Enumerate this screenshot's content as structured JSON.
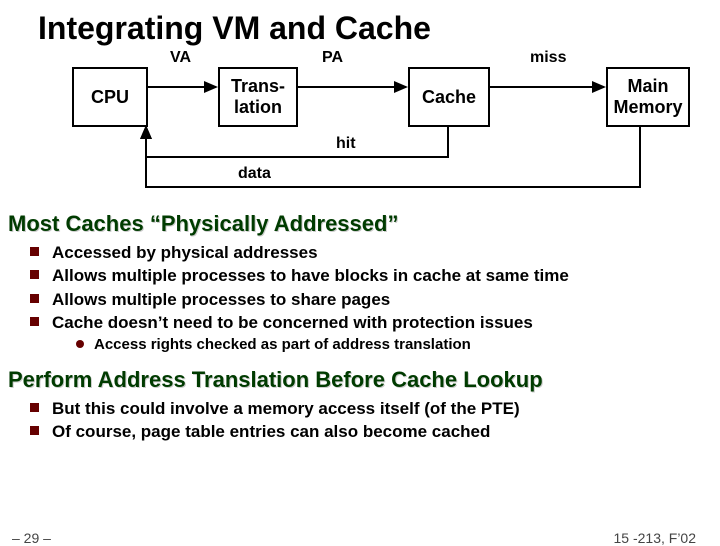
{
  "title": "Integrating VM and Cache",
  "diagram": {
    "cpu": "CPU",
    "translation": "Trans-\nlation",
    "cache": "Cache",
    "main_memory": "Main\nMemory",
    "va": "VA",
    "pa": "PA",
    "miss": "miss",
    "hit": "hit",
    "data": "data"
  },
  "section1": {
    "heading": "Most Caches “Physically Addressed”",
    "items": [
      "Accessed by physical addresses",
      "Allows multiple processes to have blocks in cache at same time",
      "Allows multiple processes to share pages",
      "Cache doesn’t need to be concerned with protection issues"
    ],
    "sub": [
      "Access rights checked as part of address translation"
    ]
  },
  "section2": {
    "heading": "Perform Address Translation Before Cache Lookup",
    "items": [
      "But this could involve a memory access itself (of the PTE)",
      "Of course, page table entries can also become cached"
    ]
  },
  "footer": {
    "left": "– 29 –",
    "right": "15 -213, F’02"
  }
}
